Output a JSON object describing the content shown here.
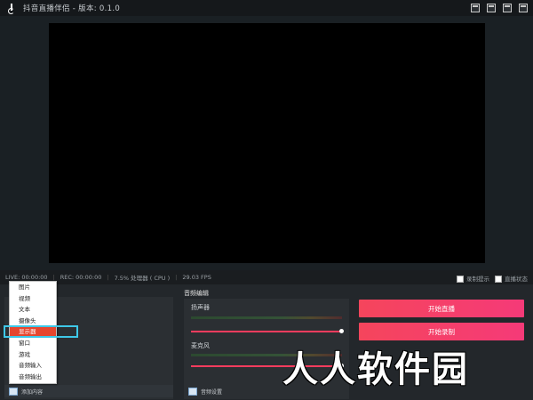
{
  "window": {
    "title": "抖音直播伴侣 - 版本: 0.1.0"
  },
  "status": {
    "live": "LIVE: 00:00:00",
    "rec": "REC: 00:00:00",
    "cpu": "7.5% 处理器 ( CPU )",
    "fps": "29.03 FPS",
    "right_check_1": "录制提示",
    "right_check_2": "直播状态"
  },
  "sources": {
    "add_label": "添加内容",
    "menu": [
      "图片",
      "视频",
      "文本",
      "摄像头",
      "显示器",
      "窗口",
      "游戏",
      "音频输入",
      "音频输出"
    ],
    "highlighted_index": 4
  },
  "audio": {
    "header": "音频编辑",
    "speaker_label": "扬声器",
    "mic_label": "麦克风",
    "speaker_level": 1.0,
    "mic_level": 1.0,
    "settings_label": "音频设置"
  },
  "actions": {
    "start_live": "开始直播",
    "start_record": "开始录制"
  },
  "watermark": "人人软件园",
  "colors": {
    "accent": "#f5455c",
    "highlight": "#e6462f",
    "outline": "#3ec8e8"
  }
}
